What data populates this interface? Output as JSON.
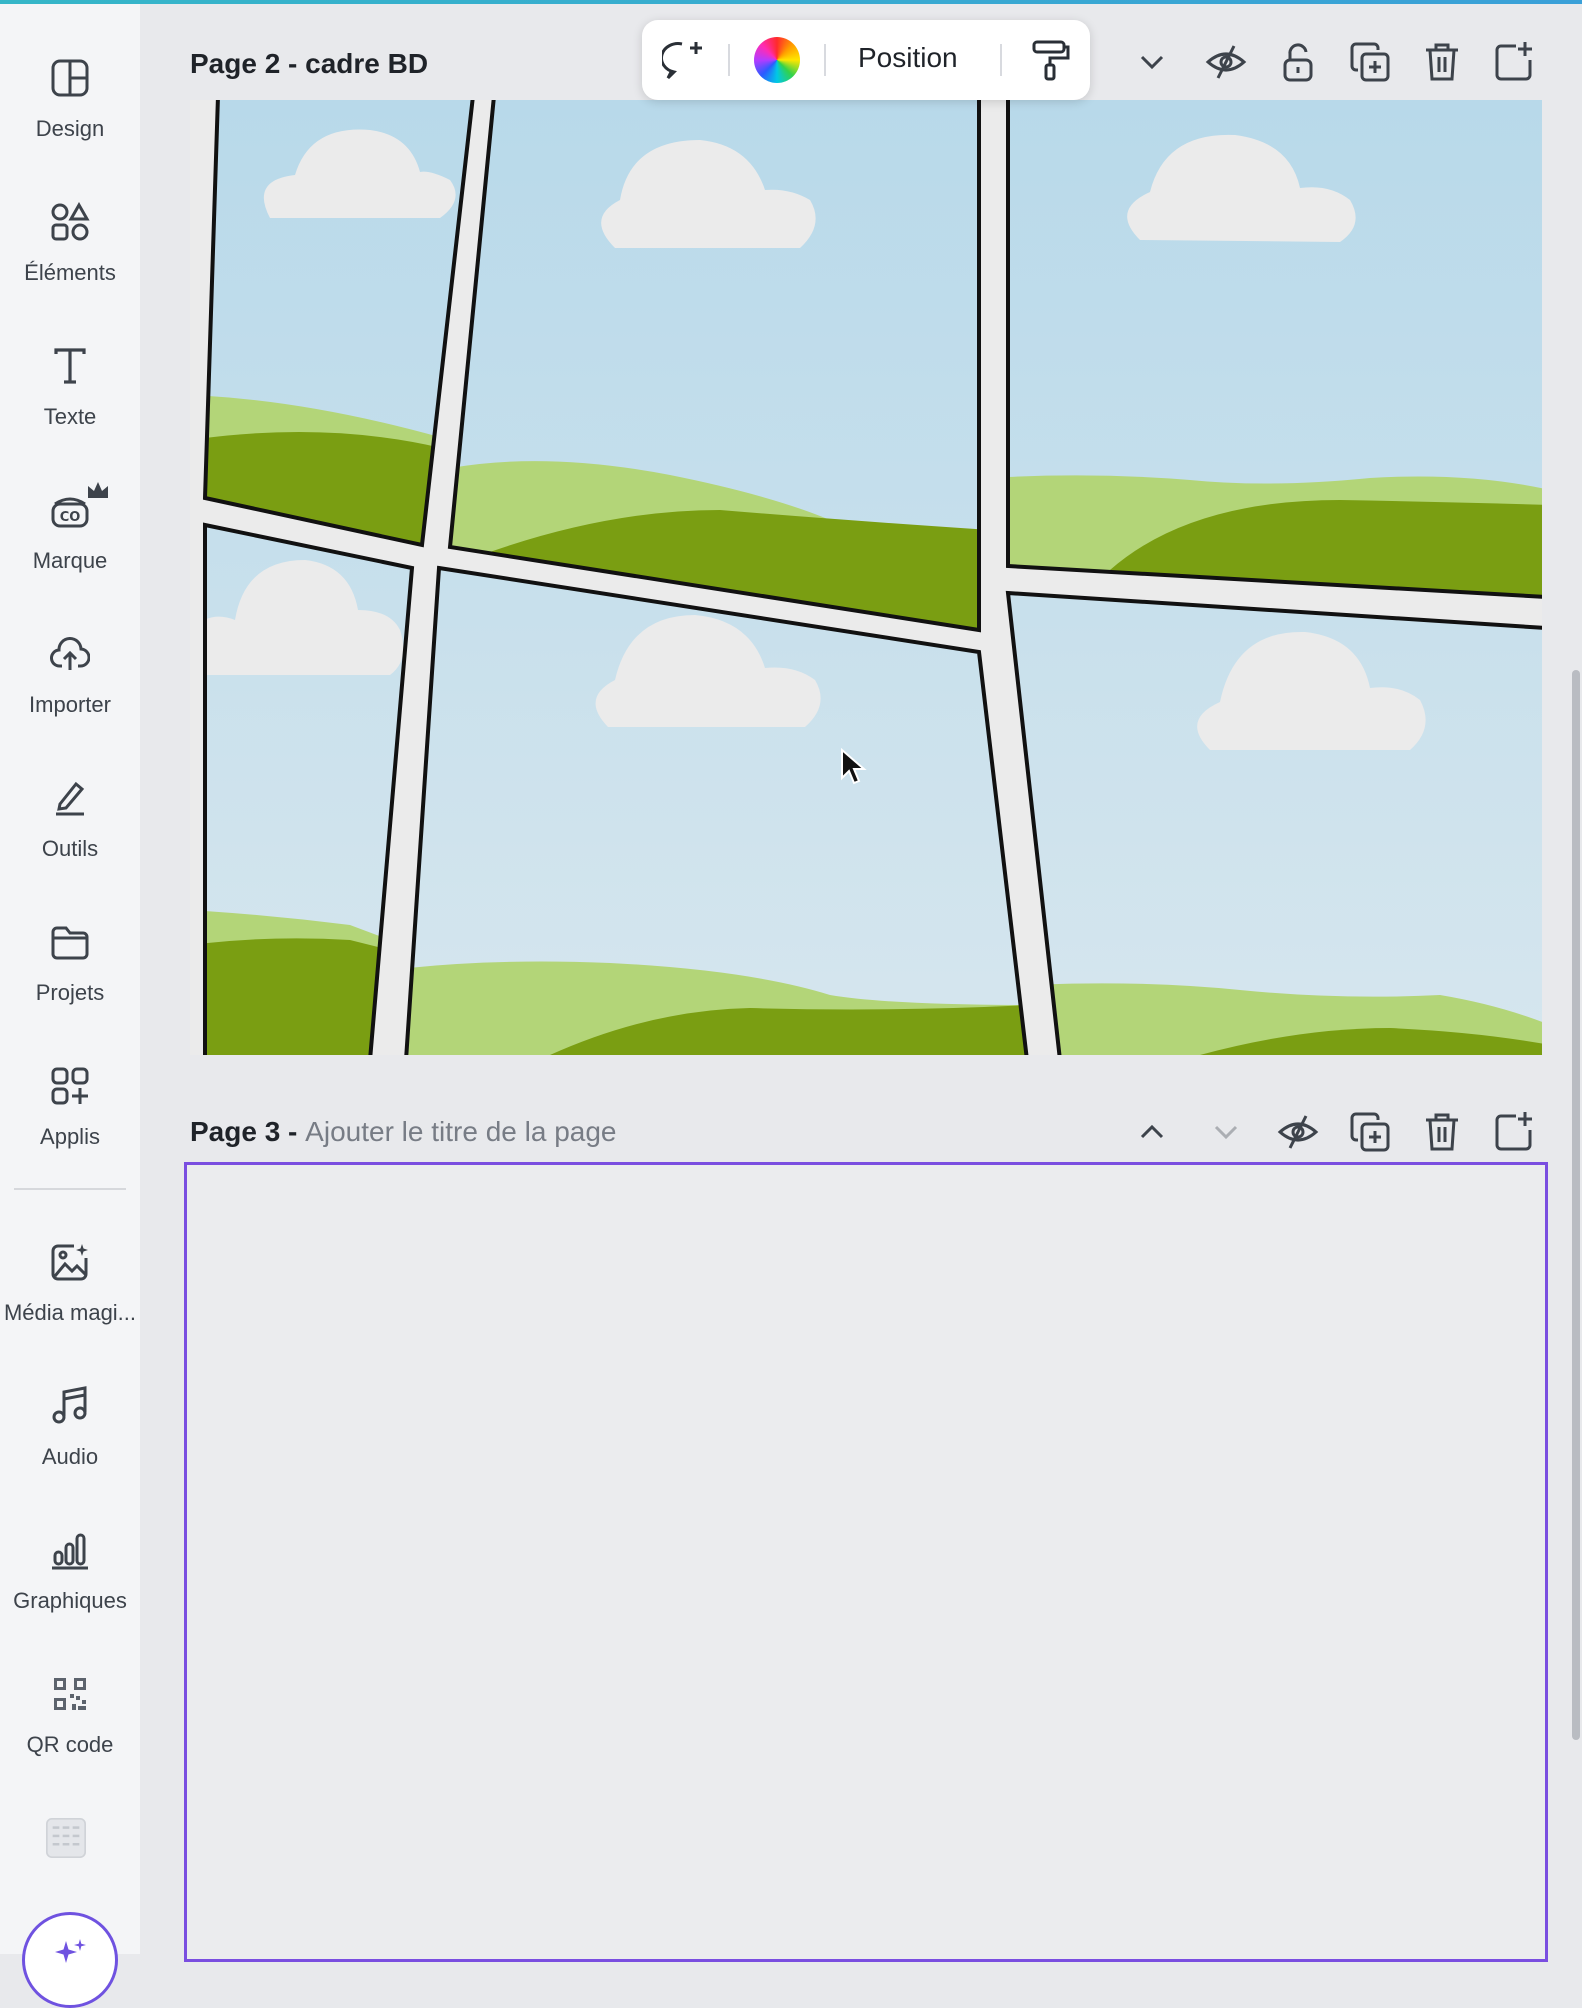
{
  "sidebar": {
    "items": [
      {
        "label": "Design",
        "icon": "design-icon"
      },
      {
        "label": "Éléments",
        "icon": "elements-icon"
      },
      {
        "label": "Texte",
        "icon": "text-icon"
      },
      {
        "label": "Marque",
        "icon": "brand-icon"
      },
      {
        "label": "Importer",
        "icon": "upload-cloud-icon"
      },
      {
        "label": "Outils",
        "icon": "draw-tools-icon"
      },
      {
        "label": "Projets",
        "icon": "folder-icon"
      },
      {
        "label": "Applis",
        "icon": "apps-icon"
      },
      {
        "label": "Média magi...",
        "icon": "magic-media-icon"
      },
      {
        "label": "Audio",
        "icon": "music-note-icon"
      },
      {
        "label": "Graphiques",
        "icon": "bar-chart-icon"
      },
      {
        "label": "QR code",
        "icon": "qr-code-icon"
      }
    ]
  },
  "page2": {
    "title": "Page 2 - cadre BD"
  },
  "page3": {
    "prefix": "Page 3 - ",
    "title_placeholder": "Ajouter le titre de la page"
  },
  "toolbar": {
    "position_label": "Position"
  },
  "colors": {
    "accent": "#7a4ee0",
    "sky": "#bcdcea",
    "hill_light": "#b3d578",
    "hill_dark": "#7a9e12",
    "cloud": "#ebebeb"
  }
}
